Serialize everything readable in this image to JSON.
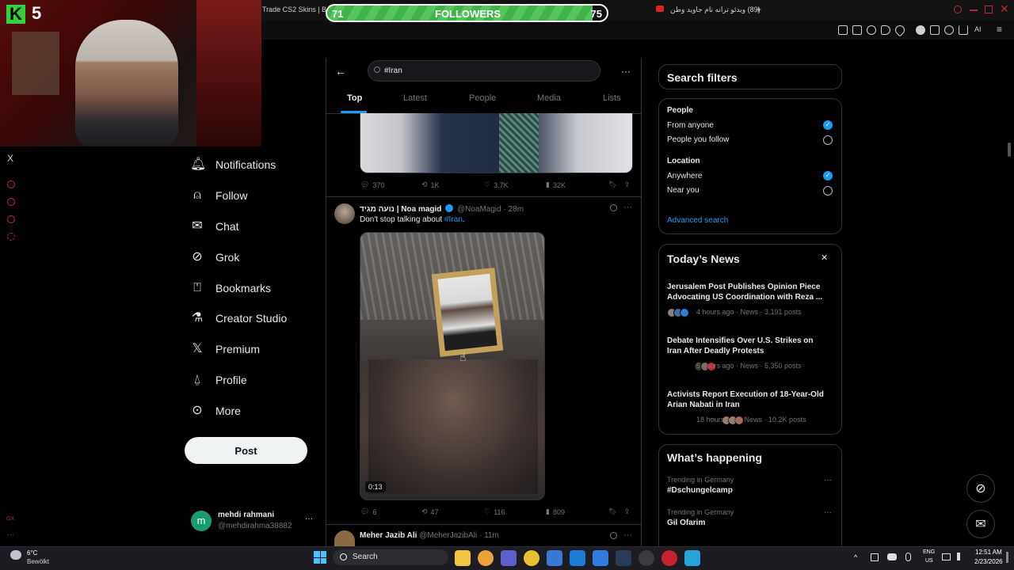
{
  "browser": {
    "tab_left": "Trade CS2 Skins | Be",
    "tab_right": "(89) ویدئو ترانه نام جاوید وطن",
    "new_tab": "+",
    "ai_label": "AI"
  },
  "overlay": {
    "webcam_badge_letter": "K",
    "webcam_badge_number": "5",
    "followers_current": "71",
    "followers_label": "FOLLOWERS",
    "followers_goal": "75",
    "followers_progress": 0.95
  },
  "rail": {
    "x_logo": "X",
    "gx_label": "GX"
  },
  "nav": {
    "items": [
      {
        "label": "Notifications",
        "icon": "bell-icon"
      },
      {
        "label": "Follow",
        "icon": "person-add-icon"
      },
      {
        "label": "Chat",
        "icon": "envelope-icon"
      },
      {
        "label": "Grok",
        "icon": "grok-icon"
      },
      {
        "label": "Bookmarks",
        "icon": "bookmark-icon"
      },
      {
        "label": "Creator Studio",
        "icon": "flask-icon"
      },
      {
        "label": "Premium",
        "icon": "x-logo-icon"
      },
      {
        "label": "Profile",
        "icon": "person-icon"
      },
      {
        "label": "More",
        "icon": "more-circle-icon"
      }
    ],
    "post_button": "Post",
    "account": {
      "avatar_letter": "m",
      "name": "mehdi rahmani",
      "handle": "@mehdirahma38882",
      "menu": "···"
    }
  },
  "search": {
    "query": "#Iran",
    "tabs": [
      "Top",
      "Latest",
      "People",
      "Media",
      "Lists"
    ],
    "active_tab": "Top"
  },
  "posts": [
    {
      "stats": {
        "replies": "370",
        "reposts": "1K",
        "likes": "3.7K",
        "views": "32K"
      }
    },
    {
      "author": "נועה מגיד | Noa magid",
      "handle": "@NoaMagid",
      "time": "· 28m",
      "text": "Don't stop talking about ",
      "hashtag": "#Iran",
      "period": ".",
      "video_duration": "0:13",
      "stats": {
        "replies": "6",
        "reposts": "47",
        "likes": "116",
        "views": "809"
      }
    },
    {
      "author": "Meher Jazib Ali",
      "handle": "@MeherJazibAli",
      "time": "· 11m"
    }
  ],
  "search_filters": {
    "title": "Search filters",
    "people_heading": "People",
    "people_options": [
      {
        "label": "From anyone",
        "checked": true
      },
      {
        "label": "People you follow",
        "checked": false
      }
    ],
    "location_heading": "Location",
    "location_options": [
      {
        "label": "Anywhere",
        "checked": true
      },
      {
        "label": "Near you",
        "checked": false
      }
    ],
    "advanced_link": "Advanced search"
  },
  "todays_news": {
    "title": "Today’s News",
    "close": "✕",
    "items": [
      {
        "headline": "Jerusalem Post Publishes Opinion Piece Advocating US Coordination with Reza ...",
        "meta": "4 hours ago · News · 3,191 posts"
      },
      {
        "headline": "Debate Intensifies Over U.S. Strikes on Iran After Deadly Protests",
        "meta": "5 hours ago · News · 5,350 posts"
      },
      {
        "headline": "Activists Report Execution of 18-Year-Old Arian Nabati in Iran",
        "meta": "18 hours ago · News · 10.2K posts"
      }
    ]
  },
  "whats_happening": {
    "title": "What’s happening",
    "items": [
      {
        "context": "Trending in Germany",
        "topic": "#Dschungelcamp"
      },
      {
        "context": "Trending in Germany",
        "topic": "Gil Ofarim"
      }
    ]
  },
  "taskbar": {
    "weather_temp": "6°C",
    "weather_desc": "Bewölkt",
    "search_label": "Search",
    "lang_top": "ENG",
    "lang_bottom": "US",
    "time": "12:51 AM",
    "date": "2/23/2026"
  },
  "colors": {
    "accent": "#1d9bf0",
    "followers_green": "#3fb24a",
    "background": "#000000"
  }
}
